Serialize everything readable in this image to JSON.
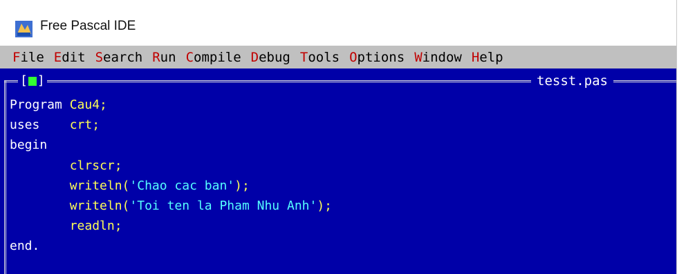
{
  "window": {
    "title": "Free Pascal IDE",
    "icon": "free-pascal-app-icon"
  },
  "menu": [
    {
      "hot": "F",
      "rest": "ile"
    },
    {
      "hot": "E",
      "rest": "dit"
    },
    {
      "hot": "S",
      "rest": "earch"
    },
    {
      "hot": "R",
      "rest": "un"
    },
    {
      "hot": "C",
      "rest": "ompile"
    },
    {
      "hot": "D",
      "rest": "ebug"
    },
    {
      "hot": "T",
      "rest": "ools"
    },
    {
      "hot": "O",
      "rest": "ptions"
    },
    {
      "hot": "W",
      "rest": "indow"
    },
    {
      "hot": "H",
      "rest": "elp"
    }
  ],
  "editor": {
    "close_box_left": "[",
    "close_box_right": "]",
    "file_name": "tesst.pas",
    "lines": [
      {
        "kw": "Program ",
        "id": "Cau4;",
        "str": ""
      },
      {
        "kw": "uses    ",
        "id": "crt;",
        "str": ""
      },
      {
        "kw": "begin",
        "id": "",
        "str": ""
      },
      {
        "kw": "        ",
        "id": "clrscr;",
        "str": ""
      },
      {
        "kw": "        ",
        "id": "writeln(",
        "str": "'Chao cac ban'",
        "tail": ");"
      },
      {
        "kw": "        ",
        "id": "writeln(",
        "str": "'Toi ten la Pham Nhu Anh'",
        "tail": ");"
      },
      {
        "kw": "        ",
        "id": "readln;",
        "str": ""
      },
      {
        "kw": "end.",
        "id": "",
        "str": ""
      }
    ]
  },
  "colors": {
    "editor_bg": "#0000a8",
    "menubar_bg": "#c0c0c0",
    "hotkey": "#c00000",
    "identifier": "#ffff55",
    "string": "#55ffff"
  }
}
